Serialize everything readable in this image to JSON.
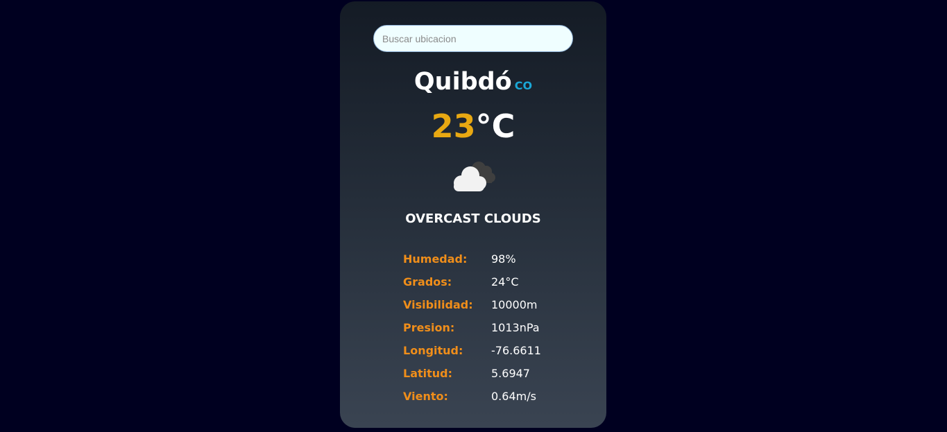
{
  "search": {
    "placeholder": "Buscar ubicacion",
    "value": ""
  },
  "location": {
    "city": "Quibdó",
    "country": "CO"
  },
  "temperature": {
    "value": "23",
    "unit": "°C"
  },
  "weather": {
    "icon": "overcast-clouds-icon",
    "description": "OVERCAST CLOUDS"
  },
  "details": [
    {
      "label": "Humedad:",
      "value": "98%"
    },
    {
      "label": "Grados:",
      "value": "24°C"
    },
    {
      "label": "Visibilidad:",
      "value": "10000m"
    },
    {
      "label": "Presion:",
      "value": "1013nPa"
    },
    {
      "label": "Longitud:",
      "value": "-76.6611"
    },
    {
      "label": "Latitud:",
      "value": "5.6947"
    },
    {
      "label": "Viento:",
      "value": "0.64m/s"
    }
  ],
  "colors": {
    "background": "#000020",
    "temp_accent": "#e8a812",
    "label_accent": "#f08e1a",
    "country_accent": "#1aa7d6"
  }
}
